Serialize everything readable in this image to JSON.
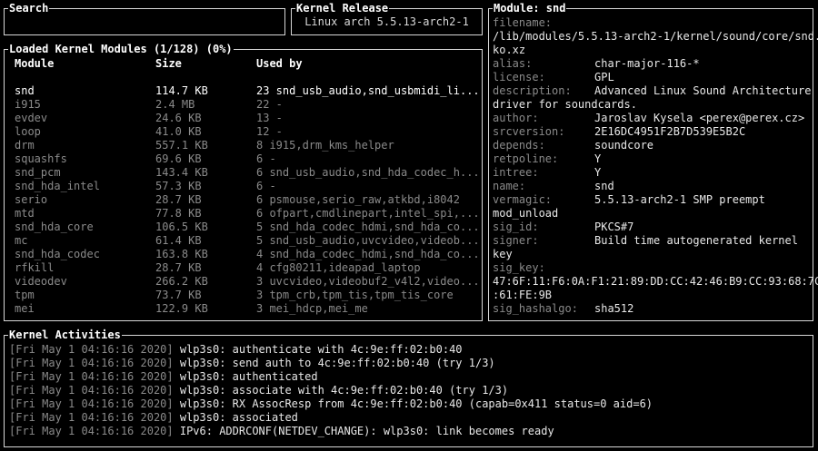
{
  "search": {
    "title": "Search",
    "value": ""
  },
  "kernel": {
    "title": "Kernel Release",
    "value": "Linux arch 5.5.13-arch2-1"
  },
  "modules": {
    "title": "Loaded Kernel Modules (1/128) (0%)",
    "headers": {
      "module": "Module",
      "size": "Size",
      "used_by": "Used by"
    },
    "rows": [
      {
        "name": "snd",
        "size": "114.7 KB",
        "used": "23 snd_usb_audio,snd_usbmidi_li...",
        "selected": true
      },
      {
        "name": "i915",
        "size": "2.4 MB",
        "used": "22 -"
      },
      {
        "name": "evdev",
        "size": "24.6 KB",
        "used": "13 -"
      },
      {
        "name": "loop",
        "size": "41.0 KB",
        "used": "12 -"
      },
      {
        "name": "drm",
        "size": "557.1 KB",
        "used": "8 i915,drm_kms_helper"
      },
      {
        "name": "squashfs",
        "size": "69.6 KB",
        "used": "6 -"
      },
      {
        "name": "snd_pcm",
        "size": "143.4 KB",
        "used": "6 snd_usb_audio,snd_hda_codec_h..."
      },
      {
        "name": "snd_hda_intel",
        "size": "57.3 KB",
        "used": "6 -"
      },
      {
        "name": "serio",
        "size": "28.7 KB",
        "used": "6 psmouse,serio_raw,atkbd,i8042"
      },
      {
        "name": "mtd",
        "size": "77.8 KB",
        "used": "6 ofpart,cmdlinepart,intel_spi,..."
      },
      {
        "name": "snd_hda_core",
        "size": "106.5 KB",
        "used": "5 snd_hda_codec_hdmi,snd_hda_co..."
      },
      {
        "name": "mc",
        "size": "61.4 KB",
        "used": "5 snd_usb_audio,uvcvideo,videob..."
      },
      {
        "name": "snd_hda_codec",
        "size": "163.8 KB",
        "used": "4 snd_hda_codec_hdmi,snd_hda_co..."
      },
      {
        "name": "rfkill",
        "size": "28.7 KB",
        "used": "4 cfg80211,ideapad_laptop"
      },
      {
        "name": "videodev",
        "size": "266.2 KB",
        "used": "3 uvcvideo,videobuf2_v4l2,video..."
      },
      {
        "name": "tpm",
        "size": "73.7 KB",
        "used": "3 tpm_crb,tpm_tis,tpm_tis_core"
      },
      {
        "name": "mei",
        "size": "122.9 KB",
        "used": "3 mei_hdcp,mei_me"
      }
    ]
  },
  "modinfo": {
    "title": "Module: snd",
    "filename_key": "filename:",
    "filename_l1": "/lib/modules/5.5.13-arch2-1/kernel/sound/core/snd.",
    "filename_l2": "ko.xz",
    "alias_key": "alias:",
    "alias": "char-major-116-*",
    "license_key": "license:",
    "license": "GPL",
    "description_key": "description:",
    "description_l1": "Advanced Linux Sound Architecture",
    "description_l2": "driver for soundcards.",
    "author_key": "author:",
    "author": "Jaroslav Kysela <perex@perex.cz>",
    "srcversion_key": "srcversion:",
    "srcversion": "2E16DC4951F2B7D539E5B2C",
    "depends_key": "depends:",
    "depends": "soundcore",
    "retpoline_key": "retpoline:",
    "retpoline": "Y",
    "intree_key": "intree:",
    "intree": "Y",
    "name_key": "name:",
    "name": "snd",
    "vermagic_key": "vermagic:",
    "vermagic": "5.5.13-arch2-1 SMP preempt",
    "vermagic_l2": "mod_unload",
    "sig_id_key": "sig_id:",
    "sig_id": "PKCS#7",
    "signer_key": "signer:",
    "signer": "Build time autogenerated kernel",
    "signer_l2": "key",
    "sig_key_key": "sig_key:",
    "sig_key_l1": "47:6F:11:F6:0A:F1:21:89:DD:CC:42:46:B9:CC:93:68:7C",
    "sig_key_l2": ":61:FE:9B",
    "sig_hashalgo_key": "sig_hashalgo:",
    "sig_hashalgo": "sha512"
  },
  "activities": {
    "title": "Kernel Activities",
    "logs": [
      {
        "ts": "[Fri May  1 04:16:16 2020]",
        "msg": "wlp3s0: authenticate with 4c:9e:ff:02:b0:40"
      },
      {
        "ts": "[Fri May  1 04:16:16 2020]",
        "msg": "wlp3s0: send auth to 4c:9e:ff:02:b0:40 (try 1/3)"
      },
      {
        "ts": "[Fri May  1 04:16:16 2020]",
        "msg": "wlp3s0: authenticated"
      },
      {
        "ts": "[Fri May  1 04:16:16 2020]",
        "msg": "wlp3s0: associate with 4c:9e:ff:02:b0:40 (try 1/3)"
      },
      {
        "ts": "[Fri May  1 04:16:16 2020]",
        "msg": "wlp3s0: RX AssocResp from 4c:9e:ff:02:b0:40 (capab=0x411 status=0 aid=6)"
      },
      {
        "ts": "[Fri May  1 04:16:16 2020]",
        "msg": "wlp3s0: associated"
      },
      {
        "ts": "[Fri May  1 04:16:16 2020]",
        "msg": "IPv6: ADDRCONF(NETDEV_CHANGE): wlp3s0: link becomes ready"
      }
    ]
  }
}
